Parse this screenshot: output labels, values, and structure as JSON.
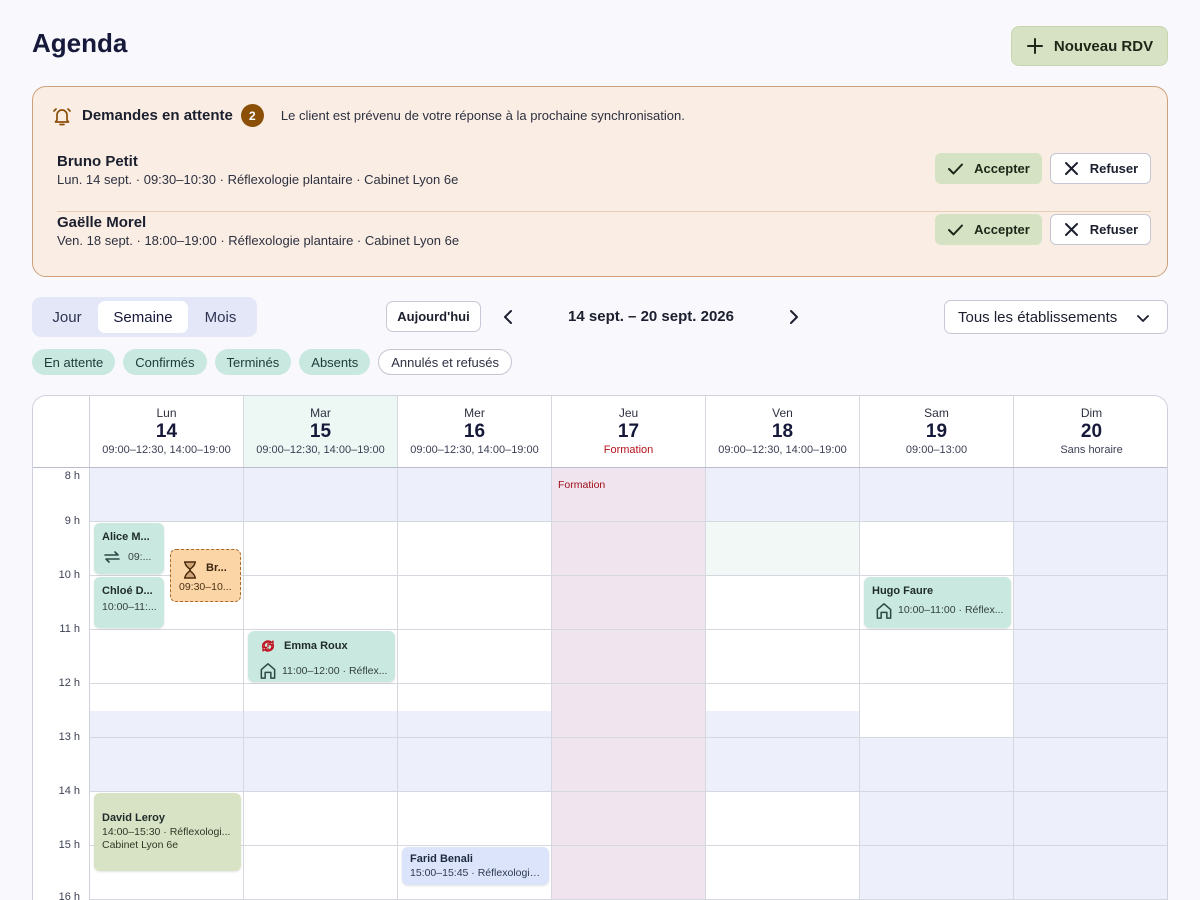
{
  "page": {
    "title": "Agenda"
  },
  "actions": {
    "new_appointment": "Nouveau RDV"
  },
  "pending": {
    "title": "Demandes en attente",
    "count": "2",
    "note": "Le client est prévenu de votre réponse à la prochaine synchronisation.",
    "accept_label": "Accepter",
    "refuse_label": "Refuser",
    "requests": [
      {
        "name": "Bruno Petit",
        "details": "Lun. 14 sept. · 09:30–10:30 · Réflexologie plantaire · Cabinet Lyon 6e"
      },
      {
        "name": "Gaëlle Morel",
        "details": "Ven. 18 sept. · 18:00–19:00 · Réflexologie plantaire · Cabinet Lyon 6e"
      }
    ]
  },
  "views": {
    "items": [
      "Jour",
      "Semaine",
      "Mois"
    ],
    "selected": "Semaine"
  },
  "nav": {
    "today": "Aujourd'hui",
    "range": "14 sept. – 20 sept. 2026"
  },
  "location_filter": {
    "selected": "Tous les établissements"
  },
  "status_filters": [
    {
      "label": "En attente",
      "active": true
    },
    {
      "label": "Confirmés",
      "active": true
    },
    {
      "label": "Terminés",
      "active": true
    },
    {
      "label": "Absents",
      "active": true
    },
    {
      "label": "Annulés et refusés",
      "active": false
    }
  ],
  "calendar": {
    "hours": [
      "8 h",
      "9 h",
      "10 h",
      "11 h",
      "12 h",
      "13 h",
      "14 h",
      "15 h",
      "16 h"
    ],
    "days": [
      {
        "name": "Lun",
        "date": "14",
        "hours": "09:00–12:30, 14:00–19:00"
      },
      {
        "name": "Mar",
        "date": "15",
        "hours": "09:00–12:30, 14:00–19:00",
        "today": true
      },
      {
        "name": "Mer",
        "date": "16",
        "hours": "09:00–12:30, 14:00–19:00"
      },
      {
        "name": "Jeu",
        "date": "17",
        "hours": "Formation",
        "closed": true
      },
      {
        "name": "Ven",
        "date": "18",
        "hours": "09:00–12:30, 14:00–19:00"
      },
      {
        "name": "Sam",
        "date": "19",
        "hours": "09:00–13:00"
      },
      {
        "name": "Dim",
        "date": "20",
        "hours": "Sans horaire"
      }
    ],
    "closure_label": "Formation",
    "events": {
      "alice": {
        "name": "Alice M...",
        "time": "09:..."
      },
      "chloe": {
        "name": "Chloé D...",
        "time": "10:00–11:..."
      },
      "bruno": {
        "name": "Br...",
        "time": "09:30–10..."
      },
      "emma": {
        "name": "Emma Roux",
        "time": "11:00–12:00 · Réflex..."
      },
      "hugo": {
        "name": "Hugo Faure",
        "time": "10:00–11:00 · Réflex..."
      },
      "david": {
        "name": "David Leroy",
        "time": "14:00–15:30 · Réflexologi...",
        "place": "Cabinet Lyon 6e"
      },
      "farid": {
        "name": "Farid Benali",
        "time": "15:00–15:45 · Réflexologie..."
      }
    }
  },
  "colors": {
    "accent_green": "#d7e2c4",
    "pending_bg": "#faeee4",
    "confirmed": "#c9e8e0",
    "pending_event": "#fbd5a6",
    "closed_day": "#f0e4ee",
    "off_hours": "#edf0fb",
    "badge": "#8c4f08"
  }
}
